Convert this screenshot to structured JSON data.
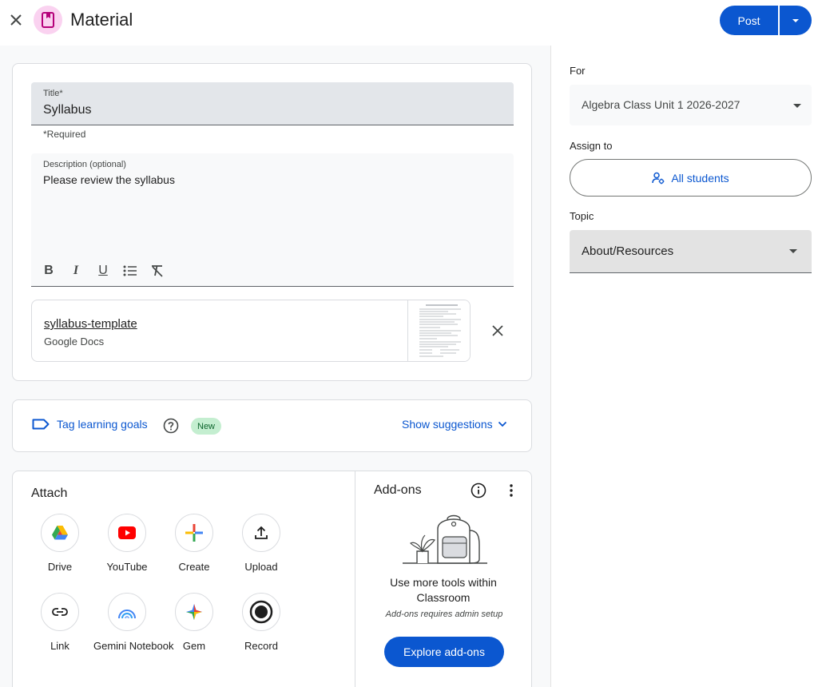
{
  "header": {
    "close_icon": "close-icon",
    "material_icon": "bookmark-icon",
    "title": "Material",
    "post_label": "Post",
    "post_menu_icon": "dropdown-arrow-icon"
  },
  "form": {
    "title_label": "Title*",
    "title_value": "Syllabus",
    "required_note": "*Required",
    "description_label": "Description (optional)",
    "description_value": "Please review the syllabus",
    "format_tools": [
      "bold-icon",
      "italic-icon",
      "underline-icon",
      "bulleted-list-icon",
      "clear-formatting-icon"
    ],
    "format_glyphs": {
      "bold": "B",
      "italic": "I",
      "underline": "U"
    },
    "attachment": {
      "name": "syllabus-template",
      "type": "Google Docs"
    }
  },
  "learning_goals": {
    "tag_label": "Tag learning goals",
    "new_badge": "New",
    "show_suggestions_label": "Show suggestions"
  },
  "attach": {
    "heading": "Attach",
    "tools": [
      {
        "label": "Drive",
        "icon": "drive-icon"
      },
      {
        "label": "YouTube",
        "icon": "youtube-icon"
      },
      {
        "label": "Create",
        "icon": "create-icon"
      },
      {
        "label": "Upload",
        "icon": "upload-icon"
      },
      {
        "label": "Link",
        "icon": "link-icon"
      },
      {
        "label": "Gemini Notebook",
        "icon": "gemini-notebook-icon"
      },
      {
        "label": "Gem",
        "icon": "gem-icon"
      },
      {
        "label": "Record",
        "icon": "record-icon"
      }
    ]
  },
  "addons": {
    "heading": "Add-ons",
    "description": "Use more tools within Classroom",
    "note": "Add-ons requires admin setup",
    "explore_label": "Explore add-ons"
  },
  "settings": {
    "for_label": "For",
    "for_value": "Algebra Class Unit 1 2026-2027",
    "assign_label": "Assign to",
    "assign_value": "All students",
    "topic_label": "Topic",
    "topic_value": "About/Resources"
  },
  "colors": {
    "primary": "#0b57d0",
    "badge_bg": "#c4eed0",
    "badge_text": "#0d652d",
    "material_bg": "#fad2f0",
    "material_icon": "#b5007a"
  }
}
